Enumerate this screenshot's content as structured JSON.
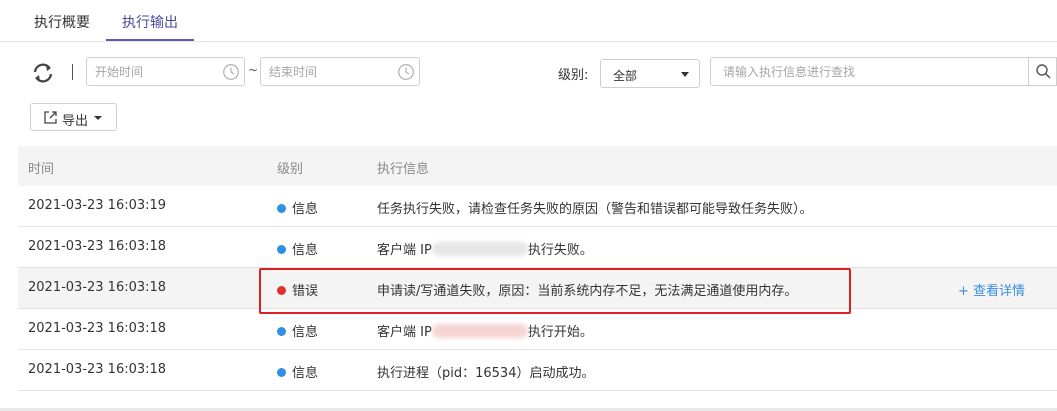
{
  "tabs": [
    {
      "label": "执行概要",
      "active": false
    },
    {
      "label": "执行输出",
      "active": true
    }
  ],
  "filters": {
    "start_placeholder": "开始时间",
    "end_placeholder": "结束时间",
    "range_sep": "~",
    "level_label": "级别:",
    "level_value": "全部",
    "search_placeholder": "请输入执行信息进行查找"
  },
  "toolbar": {
    "export_label": "导出"
  },
  "table": {
    "headers": {
      "time": "时间",
      "level": "级别",
      "message": "执行信息"
    },
    "rows": [
      {
        "time": "2021-03-23 16:03:19",
        "level": "信息",
        "message": "任务执行失败，请检查任务失败的原因（警告和错误都可能导致任务失败）。"
      },
      {
        "time": "2021-03-23 16:03:18",
        "level": "信息",
        "message_prefix": "客户端 IP",
        "message_suffix": "执行失败。"
      },
      {
        "time": "2021-03-23 16:03:18",
        "level": "错误",
        "message": "申请读/写通道失败，原因：当前系统内存不足，无法满足通道使用内存。",
        "details": "+ 查看详情"
      },
      {
        "time": "2021-03-23 16:03:18",
        "level": "信息",
        "message_prefix": "客户端 IP",
        "message_suffix": "执行开始。"
      },
      {
        "time": "2021-03-23 16:03:18",
        "level": "信息",
        "message": "执行进程（pid：16534）启动成功。"
      }
    ]
  },
  "colors": {
    "info": "#2f8fe0",
    "error": "#e03030",
    "accent": "#5a5ab0",
    "link": "#3b8de0",
    "highlight_border": "#e02020"
  }
}
